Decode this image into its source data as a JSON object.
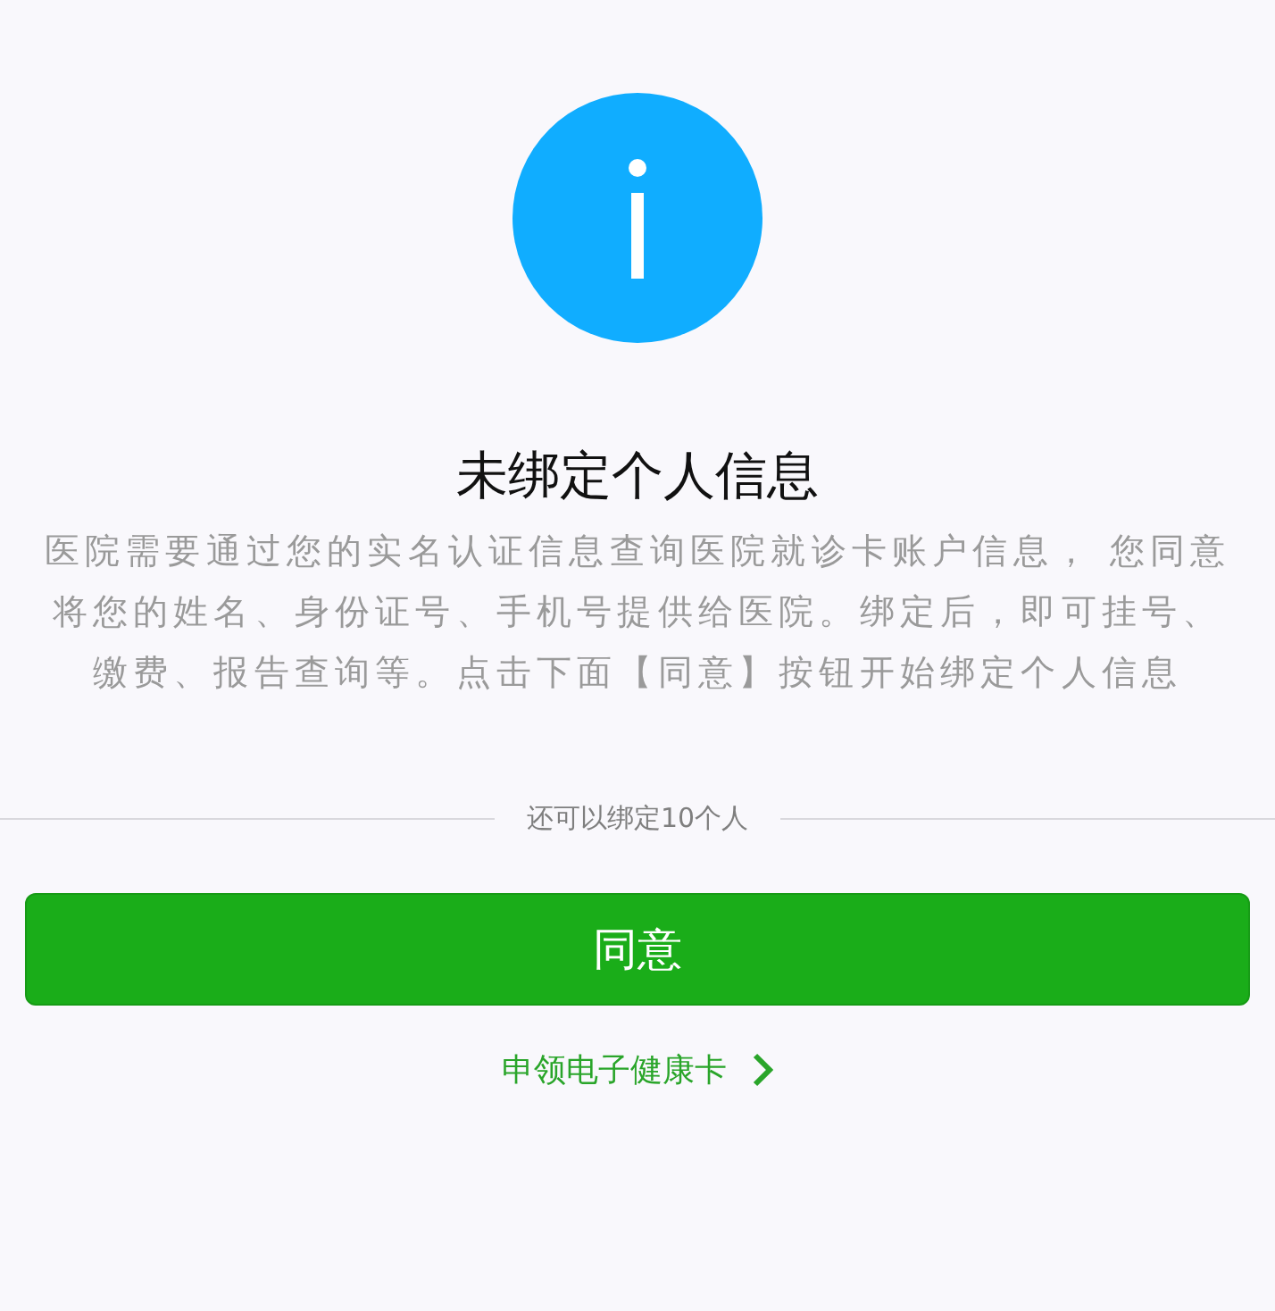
{
  "title": "未绑定个人信息",
  "description": "医院需要通过您的实名认证信息查询医院就诊卡账户信息， 您同意将您的姓名、身份证号、手机号提供给医院。绑定后，即可挂号、缴费、报告查询等。点击下面【同意】按钮开始绑定个人信息",
  "remaining_note": "还可以绑定10个人",
  "agree_button": "同意",
  "health_card_link": "申领电子健康卡"
}
